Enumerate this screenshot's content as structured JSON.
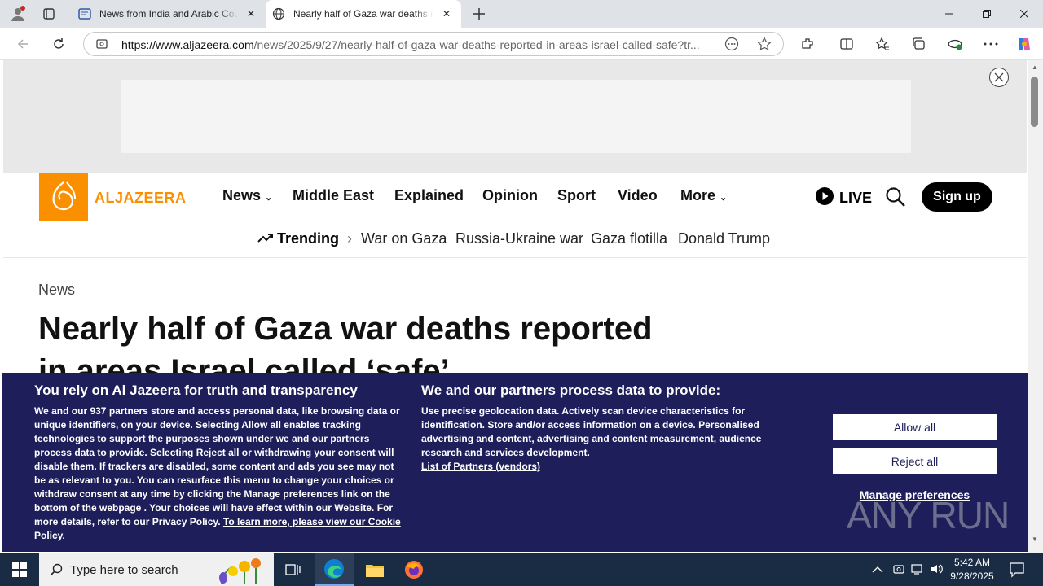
{
  "browser": {
    "tabs": [
      {
        "title": "News from India and Arabic Countries"
      },
      {
        "title": "Nearly half of Gaza war deaths reported in areas Israel called safe"
      }
    ],
    "url_domain": "https://www.aljazeera.com",
    "url_path": "/news/2025/9/27/nearly-half-of-gaza-war-deaths-reported-in-areas-israel-called-safe?tr..."
  },
  "site": {
    "logo_text": "ALJAZEERA",
    "nav": [
      "News",
      "Middle East",
      "Explained",
      "Opinion",
      "Sport",
      "Video",
      "More"
    ],
    "live_label": "LIVE",
    "signup_label": "Sign up",
    "trending_label": "Trending",
    "trending": [
      "War on Gaza",
      "Russia-Ukraine war",
      "Gaza flotilla",
      "Donald Trump"
    ]
  },
  "article": {
    "section": "News",
    "headline": "Nearly half of Gaza war deaths reported in areas Israel called ‘safe’"
  },
  "consent": {
    "left_title": "You rely on Al Jazeera for truth and transparency",
    "left_text_1": "We and our ",
    "partners_count": "937",
    "left_text_2": " partners store and access personal data, like browsing data or unique identifiers, on your device. Selecting Allow all enables tracking technologies to support the purposes shown under we and our partners process data to provide. Selecting Reject all or withdrawing your consent will disable them. If trackers are disabled, some content and ads you see may not be as relevant to you. You can resurface this menu to change your choices or withdraw consent at any time by clicking the Manage preferences link on the bottom of the webpage . Your choices will have effect within our Website. For more details, refer to our Privacy Policy. ",
    "cookie_link": "To learn more, please view our Cookie Policy.",
    "right_title": "We and our partners process data to provide:",
    "right_text": "Use precise geolocation data. Actively scan device characteristics for identification. Store and/or access information on a device. Personalised advertising and content, advertising and content measurement, audience research and services development.",
    "vendors_link": "List of Partners (vendors)",
    "allow_label": "Allow all",
    "reject_label": "Reject all",
    "manage_label": "Manage preferences"
  },
  "watermark": "ANY RUN",
  "taskbar": {
    "search_placeholder": "Type here to search",
    "time": "5:42 AM",
    "date": "9/28/2025"
  },
  "colors": {
    "brand": "#fa9000",
    "consent_bg": "#1d1e5a"
  }
}
